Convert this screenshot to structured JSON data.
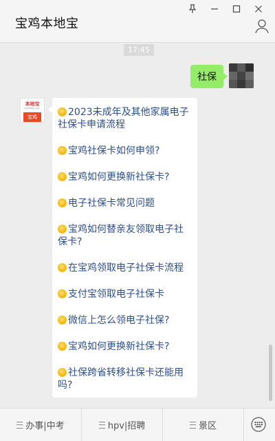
{
  "window": {
    "title": "宝鸡本地宝"
  },
  "chat": {
    "time": "17:45",
    "user_message": "社保",
    "bot_avatar": {
      "brand": "本地宝",
      "url": "bendibao.com",
      "city": "宝鸡"
    },
    "bot_items": [
      "2023未成年及其他家属电子社保卡申请流程",
      "宝鸡社保卡如何申领?",
      "宝鸡如何更换新社保卡?",
      "电子社保卡常见问题",
      "宝鸡如何替亲友领取电子社保卡?",
      "在宝鸡领取电子社保卡流程",
      "支付宝领取电子社保卡",
      "微信上怎么领电子社保?",
      "宝鸡如何更换新社保卡?",
      "社保跨省转移社保卡还能用吗?"
    ]
  },
  "bottom_menu": {
    "tabs": [
      "办事|中考",
      "hpv|招聘",
      "景区"
    ]
  },
  "colors": {
    "user_bubble": "#95ec69",
    "link": "#2d4f8a"
  },
  "icons": [
    "pin-icon",
    "minimize-icon",
    "maximize-icon",
    "close-icon",
    "profile-icon",
    "keyboard-icon",
    "sun-emoji-icon"
  ]
}
